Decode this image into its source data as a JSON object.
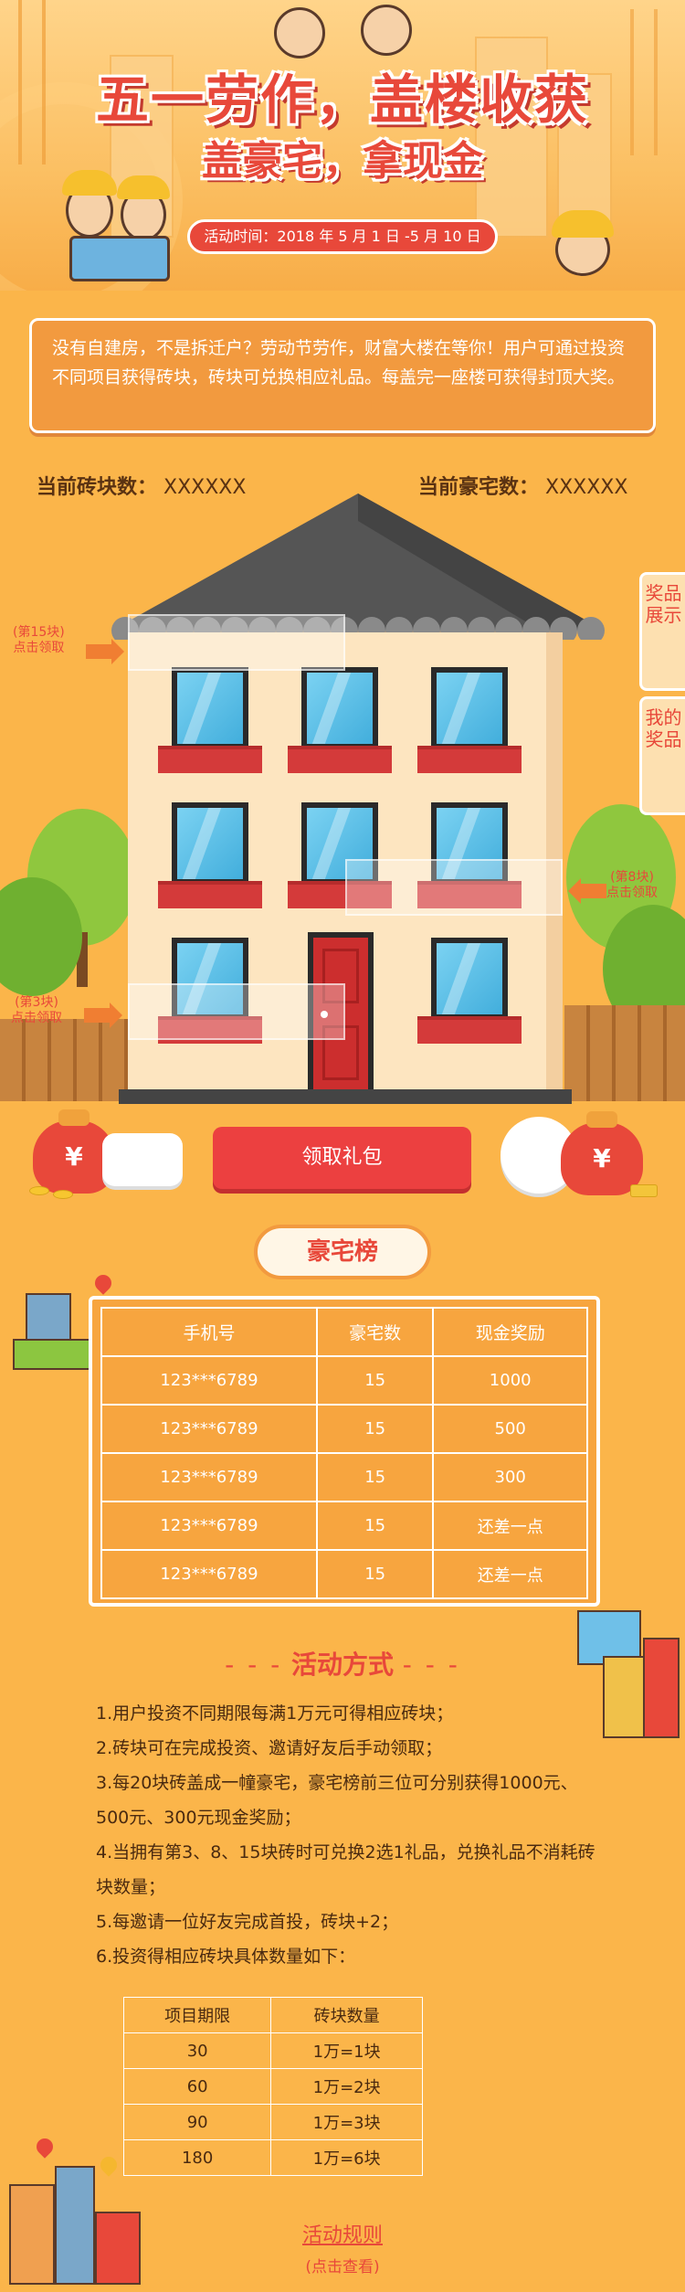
{
  "banner": {
    "title": "五一劳作，盖楼收获",
    "subtitle": "盖豪宅，拿现金",
    "date_label": "活动时间：",
    "date_value": "2018 年 5 月 1 日 -5 月 10 日"
  },
  "intro": {
    "text": "没有自建房，不是拆迁户？劳动节劳作，财富大楼在等你！用户可通过投资不同项目获得砖块，砖块可兑换相应礼品。每盖完一座楼可获得封顶大奖。"
  },
  "counts": {
    "bricks_label": "当前砖块数：",
    "bricks_value": "XXXXXX",
    "mansion_label": "当前豪宅数：",
    "mansion_value": "XXXXXX"
  },
  "side_tabs": [
    {
      "label": "奖品展示"
    },
    {
      "label": "我的奖品"
    }
  ],
  "claims": [
    {
      "tag": "(第15块)",
      "action": "点击领取"
    },
    {
      "tag": "(第8块)",
      "action": "点击领取"
    },
    {
      "tag": "(第3块)",
      "action": "点击领取"
    }
  ],
  "gift": {
    "bag_symbol": "¥",
    "button_label": "领取礼包"
  },
  "ranking": {
    "title": "豪宅榜",
    "headers": [
      "手机号",
      "豪宅数",
      "现金奖励"
    ],
    "rows": [
      [
        "123***6789",
        "15",
        "1000"
      ],
      [
        "123***6789",
        "15",
        "500"
      ],
      [
        "123***6789",
        "15",
        "300"
      ],
      [
        "123***6789",
        "15",
        "还差一点"
      ],
      [
        "123***6789",
        "15",
        "还差一点"
      ]
    ]
  },
  "rules": {
    "title": "活动方式",
    "dash": "- - -",
    "items": [
      "1.用户投资不同期限每满1万元可得相应砖块；",
      "2.砖块可在完成投资、邀请好友后手动领取；",
      "3.每20块砖盖成一幢豪宅，豪宅榜前三位可分别获得1000元、500元、300元现金奖励；",
      "4.当拥有第3、8、15块砖时可兑换2选1礼品，兑换礼品不消耗砖块数量；",
      "5.每邀请一位好友完成首投，砖块+2；",
      "6.投资得相应砖块具体数量如下："
    ],
    "qty_headers": [
      "项目期限",
      "砖块数量"
    ],
    "qty_rows": [
      [
        "30",
        "1万=1块"
      ],
      [
        "60",
        "1万=2块"
      ],
      [
        "90",
        "1万=3块"
      ],
      [
        "180",
        "1万=6块"
      ]
    ],
    "link_label": "活动规则",
    "link_hint": "(点击查看)"
  },
  "colors": {
    "page_bg": "#fbb54a",
    "accent_red": "#e8483a",
    "panel_orange": "#f29a3f"
  }
}
